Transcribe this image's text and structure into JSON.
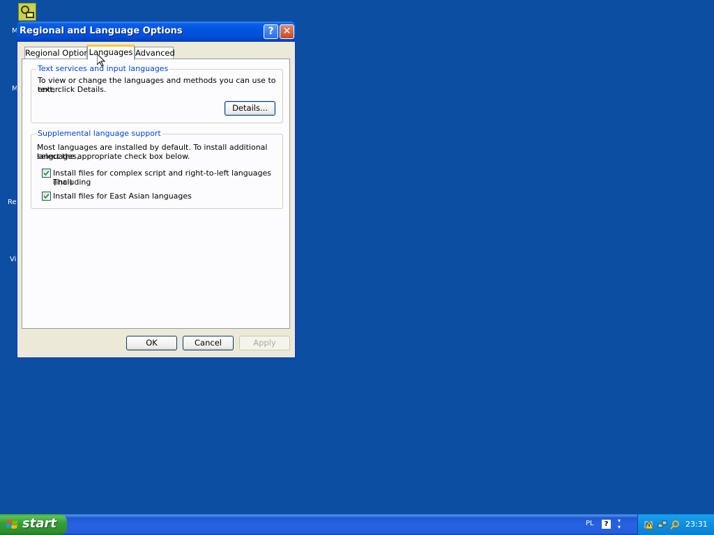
{
  "desktop": {
    "icon_labels": [
      "M",
      "M",
      "Re",
      "Vi"
    ]
  },
  "window": {
    "title": "Regional and Language Options",
    "help_glyph": "?",
    "close_glyph": "✕"
  },
  "tabs": [
    {
      "label": "Regional Options"
    },
    {
      "label": "Languages",
      "selected": true
    },
    {
      "label": "Advanced"
    }
  ],
  "text_services": {
    "group_label": "Text services and input languages",
    "description_line1": "To view or change the languages and methods you can use to enter",
    "description_line2": "text, click Details.",
    "details_button": "Details..."
  },
  "supplemental": {
    "group_label": "Supplemental language support",
    "description_line1": "Most languages are installed by default. To install additional languages,",
    "description_line2": "select the appropriate check box below.",
    "checkboxes": [
      {
        "label_line1": "Install files for complex script and right-to-left languages (including",
        "label_line2": "Thai)",
        "checked": true
      },
      {
        "label_line1": "Install files for East Asian languages",
        "checked": true
      }
    ]
  },
  "buttons": {
    "ok": "OK",
    "cancel": "Cancel",
    "apply": "Apply"
  },
  "taskbar": {
    "start_label": "start",
    "language": "PL",
    "help_icon_glyph": "?",
    "clock": "23:31"
  },
  "colors": {
    "desktop": "#0b4ea2",
    "title_bar": "#0054e3",
    "group_label": "#0046d5",
    "start_button": "#37a037",
    "tray": "#0f8ee0"
  }
}
